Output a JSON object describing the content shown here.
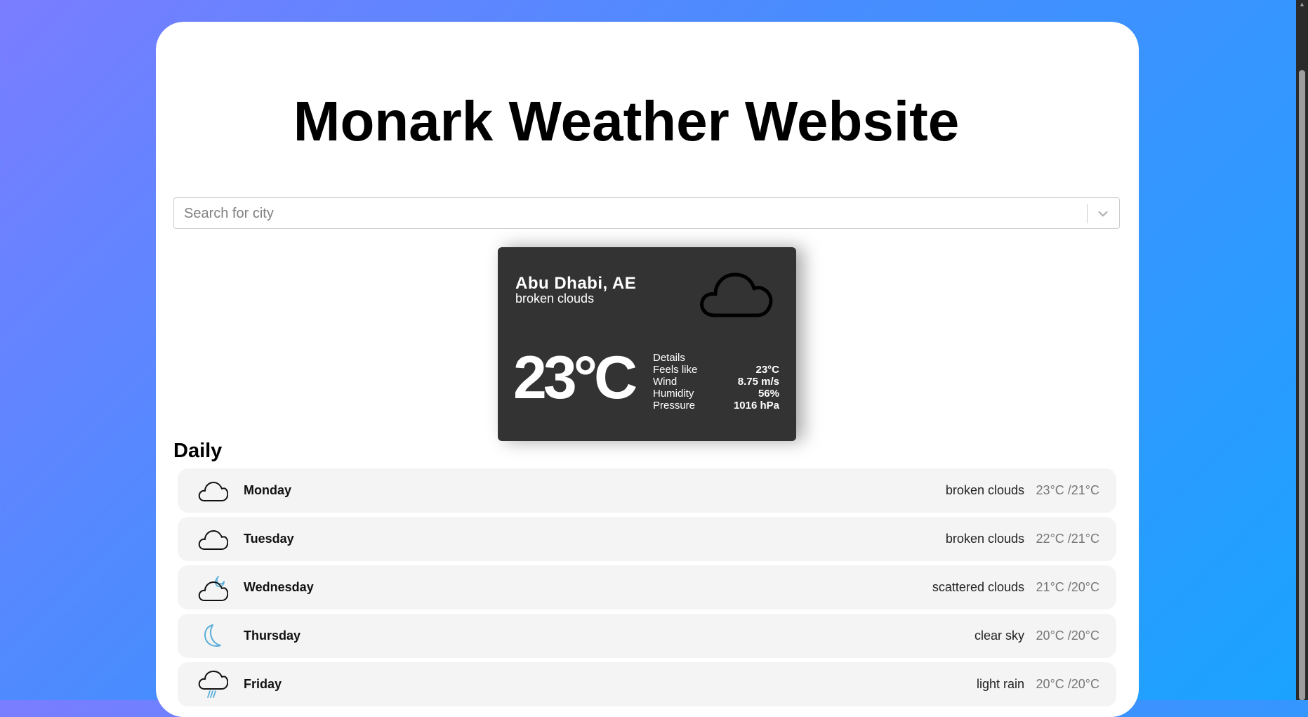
{
  "app": {
    "title": "Monark Weather Website"
  },
  "search": {
    "placeholder": "Search for city"
  },
  "current": {
    "city": "Abu Dhabi, AE",
    "description": "broken clouds",
    "temperature": "23°C",
    "icon": "cloud-icon",
    "details_label": "Details",
    "details": [
      {
        "label": "Feels like",
        "value": "23°C"
      },
      {
        "label": "Wind",
        "value": "8.75 m/s"
      },
      {
        "label": "Humidity",
        "value": "56%"
      },
      {
        "label": "Pressure",
        "value": "1016 hPa"
      }
    ]
  },
  "daily": {
    "title": "Daily",
    "days": [
      {
        "day": "Monday",
        "description": "broken clouds",
        "range": "23°C /21°C",
        "icon": "cloud-icon"
      },
      {
        "day": "Tuesday",
        "description": "broken clouds",
        "range": "22°C /21°C",
        "icon": "cloud-icon"
      },
      {
        "day": "Wednesday",
        "description": "scattered clouds",
        "range": "21°C /20°C",
        "icon": "cloud-moon-icon"
      },
      {
        "day": "Thursday",
        "description": "clear sky",
        "range": "20°C /20°C",
        "icon": "moon-icon"
      },
      {
        "day": "Friday",
        "description": "light rain",
        "range": "20°C /20°C",
        "icon": "cloud-rain-icon"
      }
    ]
  },
  "colors": {
    "card_dark": "#333333",
    "row_bg": "#f4f4f4",
    "accent_blue": "#5aaed8"
  }
}
